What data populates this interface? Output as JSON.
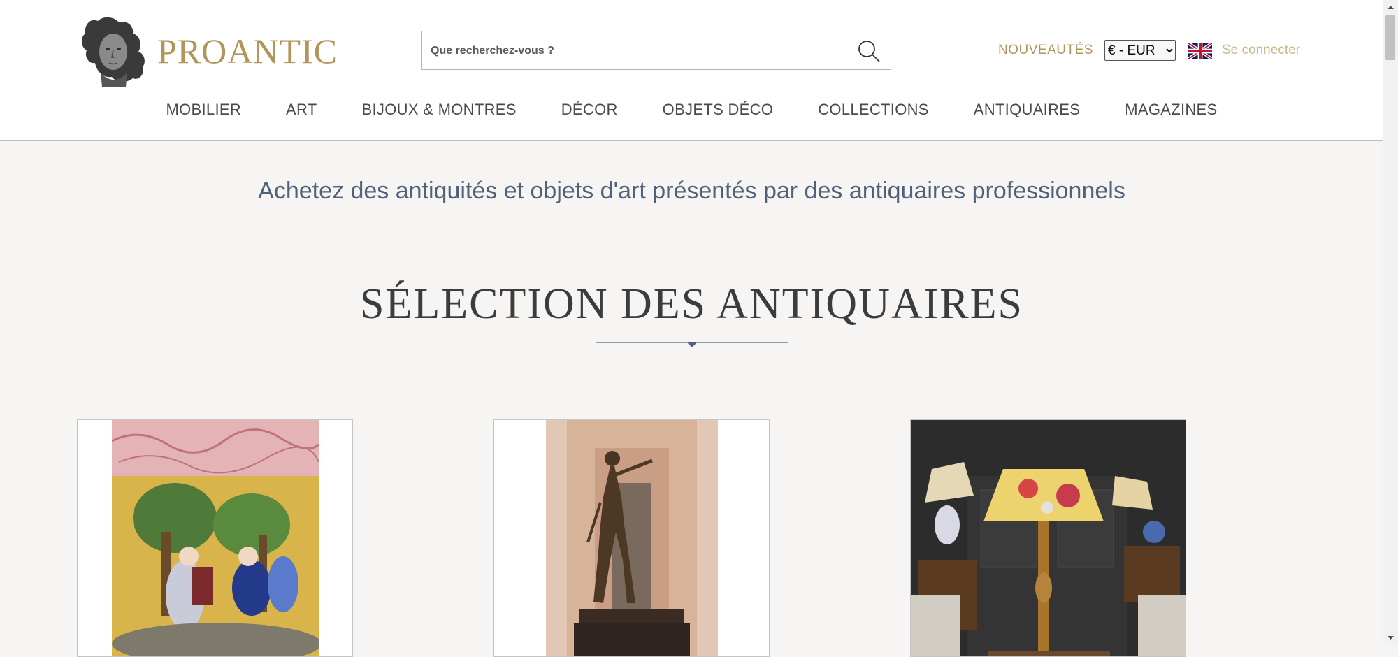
{
  "header": {
    "logo_text": "PROANTIC",
    "search": {
      "placeholder": "Que recherchez-vous ?"
    },
    "nouveautes": "NOUVEAUTÉS",
    "currency": {
      "selected": "€ - EUR"
    },
    "login": "Se connecter"
  },
  "nav": {
    "items": [
      "MOBILIER",
      "ART",
      "BIJOUX & MONTRES",
      "DÉCOR",
      "OBJETS DÉCO",
      "COLLECTIONS",
      "ANTIQUAIRES",
      "MAGAZINES"
    ]
  },
  "main": {
    "tagline": "Achetez des antiquités et objets d'art présentés par des antiquaires professionnels",
    "section_title": "SÉLECTION DES ANTIQUAIRES"
  },
  "colors": {
    "gold": "#b2955a",
    "navy": "#4f627a",
    "background": "#f6f5f3"
  },
  "icons": [
    "bust-logo-icon",
    "search-icon",
    "uk-flag-icon",
    "divider-diamond-icon"
  ]
}
